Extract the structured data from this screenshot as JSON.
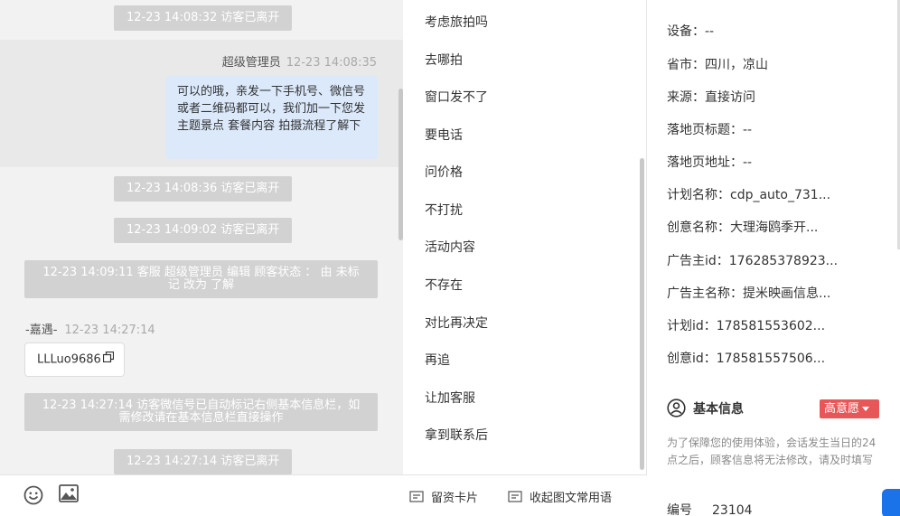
{
  "chat": {
    "sys1": "12-23 14:08:32 访客已离开",
    "self_name": "超级管理员",
    "self_time": "12-23 14:08:35",
    "self_msg": "可以的哦，亲发一下手机号、微信号或者二维码都可以，我们加一下您发主题景点 套餐内容 拍摄流程了解下",
    "sys2": "12-23 14:08:36 访客已离开",
    "sys3": "12-23 14:09:02 访客已离开",
    "sys4": "12-23 14:09:11 客服 超级管理员 编辑 顾客状态 ： 由 未标记 改为 了解",
    "visitor_name": "-嘉遇-",
    "visitor_time": "12-23 14:27:14",
    "visitor_msg": "LLLuo9686",
    "sys5": "12-23 14:27:14 访客微信号已自动标记右侧基本信息栏，如需修改请在基本信息栏直接操作",
    "sys6": "12-23 14:27:14 访客已离开"
  },
  "toolbar": {
    "emoji_icon": "smile-icon",
    "image_icon": "image-icon",
    "card_label": "留资卡片",
    "collapse_label": "收起图文常用语"
  },
  "quick_replies": [
    "考虑旅拍吗",
    "去哪拍",
    "窗口发不了",
    "要电话",
    "问价格",
    "不打扰",
    "活动内容",
    "不存在",
    "对比再决定",
    "再追",
    "让加客服",
    "拿到联系后"
  ],
  "info": {
    "rows": [
      "设备：--",
      "省市：四川，凉山",
      "来源：直接访问",
      "落地页标题：--",
      "落地页地址：--",
      "计划名称：cdp_auto_731...",
      "创意名称：大理海鸥季开...",
      "广告主id：176285378923...",
      "广告主名称：提米映画信息...",
      "计划id：178581553602...",
      "创意id：178581557506..."
    ],
    "section_title": "基本信息",
    "intent_badge": "高意愿",
    "note": "为了保障您的使用体验，会话发生当日的24点之后，顾客信息将无法修改，请及时填写",
    "id_label": "编号",
    "id_value": "23104"
  },
  "colors": {
    "badge": "#e85757",
    "self_bubble": "#dbe9fb",
    "system_bg": "#d2d2d2"
  }
}
